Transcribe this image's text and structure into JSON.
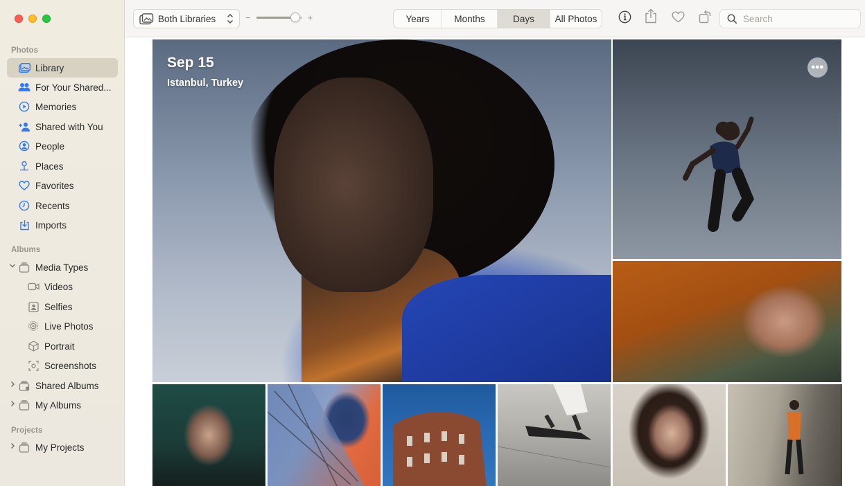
{
  "sidebar": {
    "sections": {
      "photos": "Photos",
      "albums": "Albums",
      "projects": "Projects"
    },
    "photos_items": [
      {
        "label": "Library",
        "icon": "library-icon"
      },
      {
        "label": "For Your Shared...",
        "icon": "people-pair-icon"
      },
      {
        "label": "Memories",
        "icon": "memories-icon"
      },
      {
        "label": "Shared with You",
        "icon": "shared-with-you-icon"
      },
      {
        "label": "People",
        "icon": "person-circle-icon"
      },
      {
        "label": "Places",
        "icon": "pin-icon"
      },
      {
        "label": "Favorites",
        "icon": "heart-icon"
      },
      {
        "label": "Recents",
        "icon": "clock-icon"
      },
      {
        "label": "Imports",
        "icon": "import-icon"
      }
    ],
    "albums_items": [
      {
        "label": "Media Types",
        "icon": "album-stack-icon",
        "expanded": true
      },
      {
        "label": "Videos",
        "icon": "video-icon"
      },
      {
        "label": "Selfies",
        "icon": "selfie-icon"
      },
      {
        "label": "Live Photos",
        "icon": "live-photo-icon"
      },
      {
        "label": "Portrait",
        "icon": "cube-icon"
      },
      {
        "label": "Screenshots",
        "icon": "screenshot-icon"
      },
      {
        "label": "Shared Albums",
        "icon": "shared-album-icon",
        "expanded": false
      },
      {
        "label": "My Albums",
        "icon": "album-stack-icon",
        "expanded": false
      }
    ],
    "projects_items": [
      {
        "label": "My Projects",
        "icon": "album-stack-icon",
        "expanded": false
      }
    ],
    "selected": "Library"
  },
  "toolbar": {
    "library_select": "Both Libraries",
    "zoom_minus": "−",
    "zoom_plus": "+",
    "zoom_level": 0.85,
    "segments": [
      "Years",
      "Months",
      "Days",
      "All Photos"
    ],
    "active_segment": "Days",
    "search_placeholder": "Search"
  },
  "grid": {
    "date": "Sep 15",
    "location": "Istanbul, Turkey",
    "more_label": "•••"
  },
  "colors": {
    "accent": "#2f7cf6",
    "sidebar_bg": "#efeae0",
    "selected_row": "#d8d2c3"
  }
}
